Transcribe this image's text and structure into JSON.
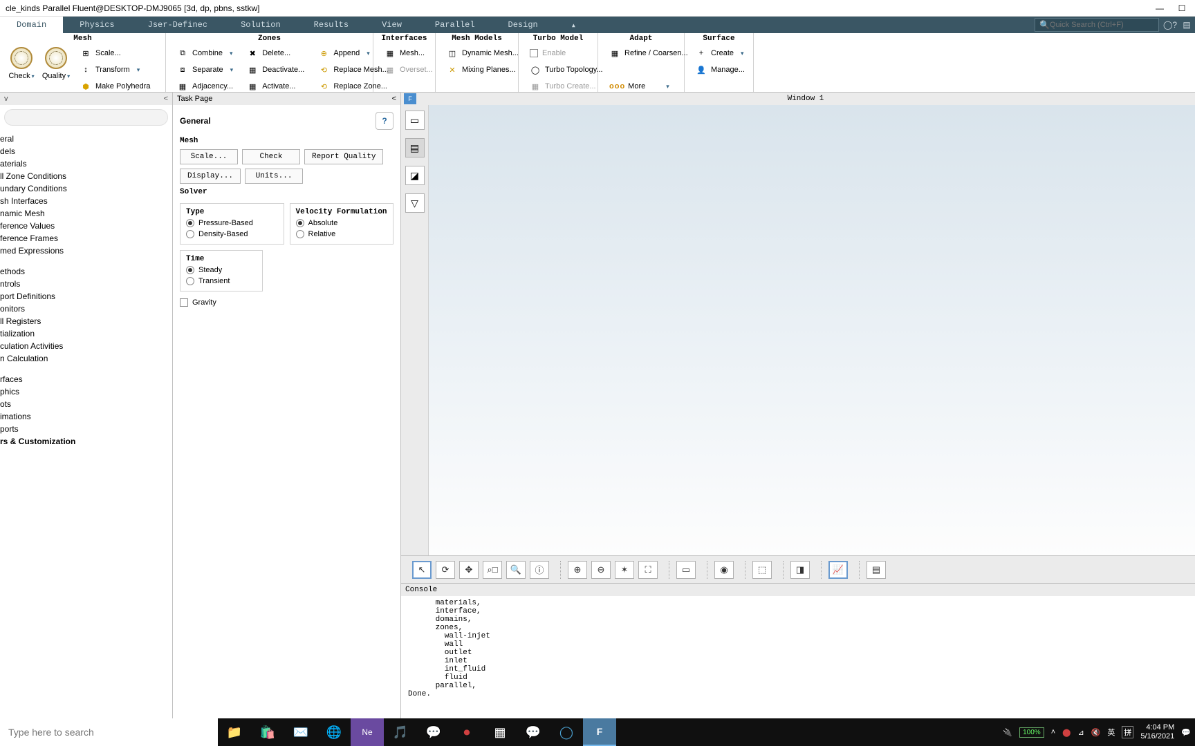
{
  "window": {
    "title": "cle_kinds Parallel Fluent@DESKTOP-DMJ9065  [3d, dp, pbns, sstkw]"
  },
  "menu": {
    "tabs": [
      "Domain",
      "Physics",
      "Jser-Definec",
      "Solution",
      "Results",
      "View",
      "Parallel",
      "Design"
    ],
    "active": "Domain",
    "search_placeholder": "Quick Search (Ctrl+F)"
  },
  "ribbon": {
    "mesh": {
      "label": "Mesh",
      "check": "Check",
      "quality": "Quality",
      "scale": "Scale...",
      "transform": "Transform",
      "polyhedra": "Make Polyhedra"
    },
    "zones": {
      "label": "Zones",
      "combine": "Combine",
      "separate": "Separate",
      "adjacency": "Adjacency...",
      "delete": "Delete...",
      "deactivate": "Deactivate...",
      "activate": "Activate...",
      "append": "Append",
      "replace_mesh": "Replace Mesh...",
      "replace_zone": "Replace Zone..."
    },
    "interfaces": {
      "label": "Interfaces",
      "mesh": "Mesh...",
      "overset": "Overset..."
    },
    "mesh_models": {
      "label": "Mesh Models",
      "dynamic": "Dynamic Mesh...",
      "mixing": "Mixing Planes..."
    },
    "turbo": {
      "label": "Turbo Model",
      "enable": "Enable",
      "topology": "Turbo Topology...",
      "create": "Turbo Create..."
    },
    "adapt": {
      "label": "Adapt",
      "refine": "Refine / Coarsen...",
      "more": "More"
    },
    "surface": {
      "label": "Surface",
      "create": "Create",
      "manage": "Manage..."
    }
  },
  "tree": {
    "items": [
      {
        "label": "eral"
      },
      {
        "label": "dels"
      },
      {
        "label": "aterials"
      },
      {
        "label": "ll Zone Conditions"
      },
      {
        "label": "undary Conditions"
      },
      {
        "label": "sh Interfaces"
      },
      {
        "label": "namic Mesh"
      },
      {
        "label": "ference Values"
      },
      {
        "label": "ference Frames"
      },
      {
        "label": "med Expressions"
      },
      {
        "label": ""
      },
      {
        "label": "ethods"
      },
      {
        "label": "ntrols"
      },
      {
        "label": "port Definitions"
      },
      {
        "label": "onitors"
      },
      {
        "label": "ll Registers"
      },
      {
        "label": "tialization"
      },
      {
        "label": "culation Activities"
      },
      {
        "label": "n Calculation"
      },
      {
        "label": ""
      },
      {
        "label": "rfaces"
      },
      {
        "label": "phics"
      },
      {
        "label": "ots"
      },
      {
        "label": "imations"
      },
      {
        "label": "ports"
      },
      {
        "label": "rs & Customization",
        "bold": true
      }
    ]
  },
  "task": {
    "header": "Task Page",
    "title": "General",
    "mesh_label": "Mesh",
    "scale": "Scale...",
    "check": "Check",
    "report_quality": "Report Quality",
    "display": "Display...",
    "units": "Units...",
    "solver_label": "Solver",
    "type_label": "Type",
    "vel_label": "Velocity Formulation",
    "pressure": "Pressure-Based",
    "density": "Density-Based",
    "absolute": "Absolute",
    "relative": "Relative",
    "time_label": "Time",
    "steady": "Steady",
    "transient": "Transient",
    "gravity": "Gravity"
  },
  "graphics": {
    "window_label": "Window 1",
    "tab": "F"
  },
  "console": {
    "header": "Console",
    "text": "      materials,\n      interface,\n      domains,\n      zones,\n        wall-injet\n        wall\n        outlet\n        inlet\n        int_fluid\n        fluid\n      parallel,\nDone."
  },
  "taskbar": {
    "search_placeholder": "Type here to search",
    "battery": "100%",
    "ime1": "英",
    "ime2": "拼",
    "time": "4:04 PM",
    "date": "5/16/2021"
  }
}
